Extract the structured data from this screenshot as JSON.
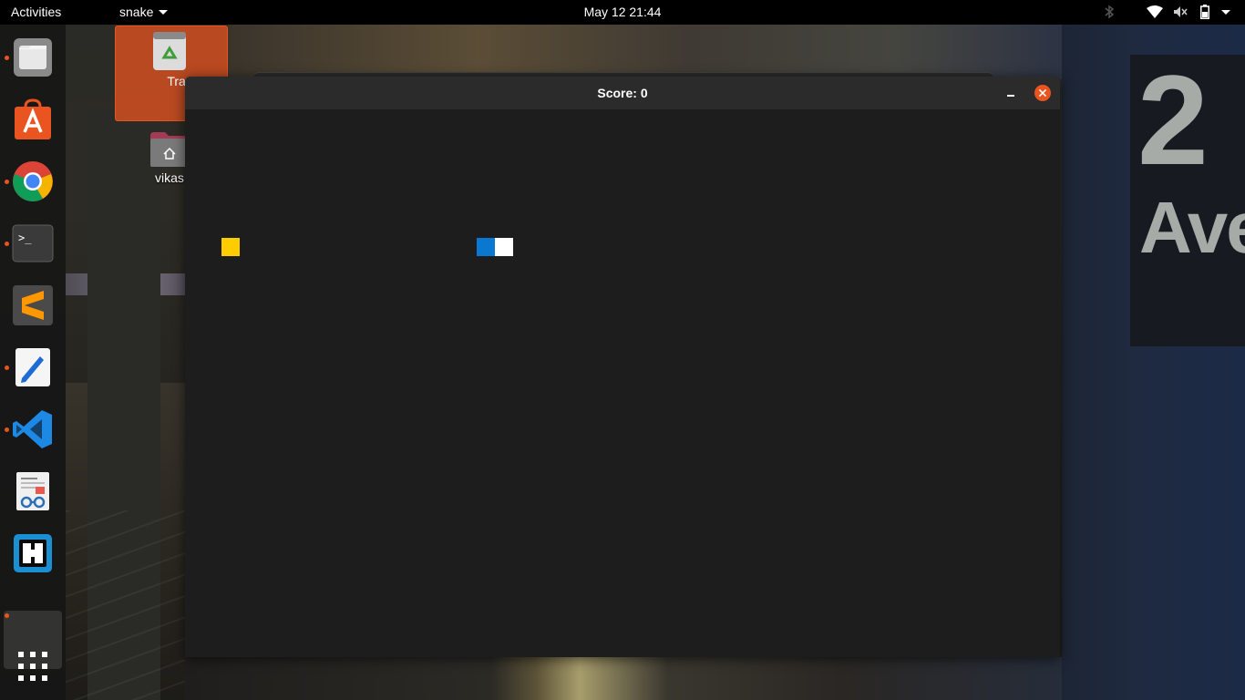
{
  "topbar": {
    "activities": "Activities",
    "app_menu": "snake",
    "clock": "May 12  21:44",
    "tray_icons": [
      "bluetooth-icon",
      "wifi-icon",
      "volume-icon",
      "battery-icon",
      "system-menu-arrow"
    ]
  },
  "dock": {
    "items": [
      {
        "name": "files",
        "icon": "files-icon",
        "running": true
      },
      {
        "name": "ubuntu-software",
        "icon": "software-center-icon",
        "running": false
      },
      {
        "name": "google-chrome",
        "icon": "chrome-icon",
        "running": true
      },
      {
        "name": "terminal",
        "icon": "terminal-icon",
        "running": true
      },
      {
        "name": "sublime-text",
        "icon": "sublime-icon",
        "running": false
      },
      {
        "name": "text-editor",
        "icon": "text-editor-icon",
        "running": true
      },
      {
        "name": "visual-studio-code",
        "icon": "vscode-icon",
        "running": true
      },
      {
        "name": "document-viewer",
        "icon": "document-viewer-icon",
        "running": false
      },
      {
        "name": "meld",
        "icon": "meld-icon",
        "running": false
      },
      {
        "name": "snake",
        "icon": "snake-window-icon",
        "running": true,
        "active": true
      }
    ],
    "show_apps_icon": "show-applications-icon",
    "terminal_prompt": ">_"
  },
  "desktop": {
    "trash_label": "Trash",
    "home_label": "vikas"
  },
  "wallpaper": {
    "sign_number": "2",
    "sign_text": "Ave"
  },
  "window": {
    "title": "Score: 0",
    "colors": {
      "background": "#1d1d1d",
      "food": "#ffcc00",
      "snake_body": "#0a78d0",
      "snake_head": "#ffffff",
      "close_button": "#e95420"
    }
  }
}
